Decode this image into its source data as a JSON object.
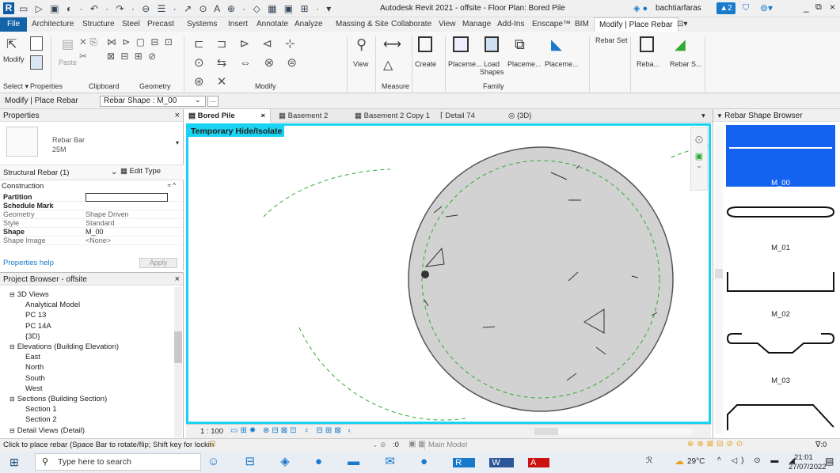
{
  "app": {
    "title": "Autodesk Revit 2021 - offsite - Floor Plan: Bored Pile",
    "user": "bachtiarfaras",
    "notif_count": "2",
    "logo_letter": "R"
  },
  "tabs": [
    "File",
    "Architecture",
    "Structure",
    "Steel",
    "Precast",
    "Systems",
    "Insert",
    "Annotate",
    "Analyze",
    "Massing & Site",
    "Collaborate",
    "View",
    "Manage",
    "Add-Ins",
    "Enscape™",
    "BIM",
    "Modify | Place Rebar"
  ],
  "ribbon": {
    "modify": "Modify",
    "paste": "Paste",
    "view": "View",
    "create": "Create",
    "placement": "Placeme...",
    "load_shapes": "Load Shapes",
    "placement2": "Placeme...",
    "placement3": "Placeme...",
    "rebar_set": "Rebar Set",
    "reba": "Reba...",
    "rebar_s": "Rebar S...",
    "groups": {
      "select": "Select ▾",
      "properties": "Properties",
      "clipboard": "Clipboard",
      "geometry": "Geometry",
      "modify": "Modify",
      "measure": "Measure",
      "family": "Family"
    }
  },
  "optbar": {
    "context": "Modify | Place Rebar",
    "shape_label": "Rebar Shape : M_00"
  },
  "properties": {
    "title": "Properties",
    "type_line1": "Rebar Bar",
    "type_line2": "25M",
    "instance": "Structural Rebar (1)",
    "edit_type": "Edit Type",
    "section": "Construction",
    "rows": [
      {
        "k": "Partition",
        "v": ""
      },
      {
        "k": "Schedule Mark",
        "v": ""
      },
      {
        "k": "Geometry",
        "v": "Shape Driven"
      },
      {
        "k": "Style",
        "v": "Standard"
      },
      {
        "k": "Shape",
        "v": "M_00"
      },
      {
        "k": "Shape Image",
        "v": "<None>"
      }
    ],
    "help": "Properties help",
    "apply": "Apply"
  },
  "browser": {
    "title": "Project Browser - offsite",
    "items": [
      {
        "label": "3D Views",
        "level": 1,
        "expand": "⊟"
      },
      {
        "label": "Analytical Model",
        "level": 2
      },
      {
        "label": "PC 13",
        "level": 2
      },
      {
        "label": "PC 14A",
        "level": 2
      },
      {
        "label": "{3D}",
        "level": 2
      },
      {
        "label": "Elevations (Building Elevation)",
        "level": 1,
        "expand": "⊟"
      },
      {
        "label": "East",
        "level": 2
      },
      {
        "label": "North",
        "level": 2
      },
      {
        "label": "South",
        "level": 2
      },
      {
        "label": "West",
        "level": 2
      },
      {
        "label": "Sections (Building Section)",
        "level": 1,
        "expand": "⊟"
      },
      {
        "label": "Section 1",
        "level": 2
      },
      {
        "label": "Section 2",
        "level": 2
      },
      {
        "label": "Detail Views (Detail)",
        "level": 1,
        "expand": "⊟"
      }
    ]
  },
  "viewtabs": [
    "Bored Pile",
    "Basement 2",
    "Basement 2 Copy 1",
    "Detail 74",
    "{3D}"
  ],
  "canvas": {
    "banner": "Temporary Hide/Isolate",
    "scale": "1 : 100"
  },
  "shapebrowser": {
    "title": "Rebar Shape Browser",
    "shapes": [
      "M_00",
      "M_01",
      "M_02",
      "M_03"
    ]
  },
  "status": {
    "hint": "Click to place rebar (Space Bar to rotate/flip; Shift key for lockin",
    "zero": ":0",
    "model": "Main Model",
    "filter": "∇:0"
  },
  "taskbar": {
    "search": "Type here to search",
    "temp": "29°C",
    "time": "21:01",
    "date": "27/07/2022"
  },
  "colors": {
    "accent": "#1979ca",
    "canvas_border": "#19d3f2",
    "selected_shape": "#1463f0",
    "revit_blue": "#0e5aa7"
  }
}
